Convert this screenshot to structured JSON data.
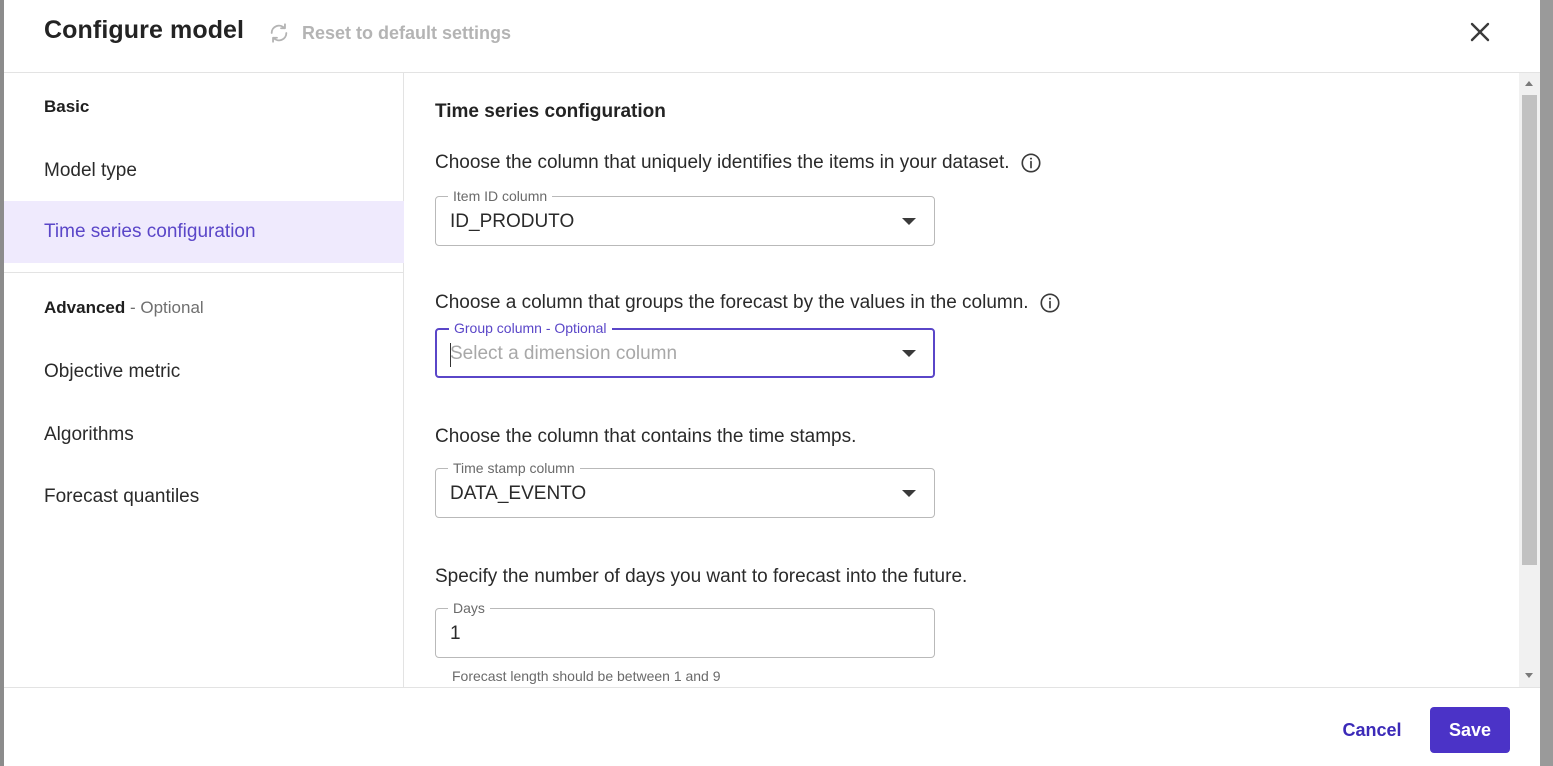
{
  "dialog": {
    "title": "Configure model",
    "reset_label": "Reset to default settings"
  },
  "sidebar": {
    "basic_label": "Basic",
    "advanced_label": "Advanced",
    "advanced_optional": " - Optional",
    "items": [
      {
        "label": "Model type"
      },
      {
        "label": "Time series configuration",
        "active": true
      },
      {
        "label": "Objective metric"
      },
      {
        "label": "Algorithms"
      },
      {
        "label": "Forecast quantiles"
      }
    ]
  },
  "content": {
    "section_title": "Time series configuration",
    "item_id": {
      "prompt": "Choose the column that uniquely identifies the items in your dataset.",
      "label": "Item ID column",
      "value": "ID_PRODUTO"
    },
    "group": {
      "prompt": "Choose a column that groups the forecast by the values in the column.",
      "label": "Group column - Optional",
      "placeholder": "Select a dimension column"
    },
    "timestamp": {
      "prompt": "Choose the column that contains the time stamps.",
      "label": "Time stamp column",
      "value": "DATA_EVENTO"
    },
    "days": {
      "prompt": "Specify the number of days you want to forecast into the future.",
      "label": "Days",
      "value": "1",
      "helper": "Forecast length should be between 1 and 9"
    }
  },
  "footer": {
    "cancel_label": "Cancel",
    "save_label": "Save"
  },
  "colors": {
    "accent": "#4b33c7",
    "active_bg": "#efeafd",
    "active_text": "#5a46c8"
  },
  "icons": [
    "refresh-icon",
    "close-icon",
    "info-icon",
    "chevron-down-icon"
  ]
}
